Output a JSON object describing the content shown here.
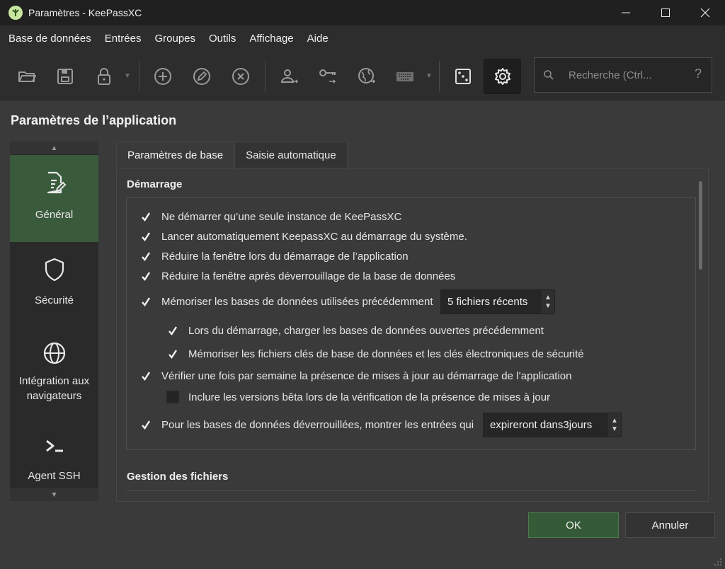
{
  "window": {
    "title": "Paramètres - KeePassXC",
    "controls": [
      "minimize",
      "maximize",
      "close"
    ]
  },
  "menu": [
    "Base de données",
    "Entrées",
    "Groupes",
    "Outils",
    "Affichage",
    "Aide"
  ],
  "toolbar": {
    "buttons": [
      "open-database",
      "save-database",
      "lock-database",
      "add-entry",
      "edit-entry",
      "delete-entry",
      "copy-username",
      "copy-password",
      "open-url",
      "auto-type",
      "password-generator",
      "settings"
    ],
    "search_placeholder": "Recherche (Ctrl...",
    "search_help": "?"
  },
  "page_title": "Paramètres de l’application",
  "categories": [
    {
      "label": "Général",
      "icon": "document-edit-icon",
      "active": true
    },
    {
      "label": "Sécurité",
      "icon": "shield-icon",
      "active": false
    },
    {
      "label": "Intégration aux navigateurs",
      "icon": "globe-icon",
      "active": false
    },
    {
      "label": "Agent SSH",
      "icon": "terminal-icon",
      "active": false
    }
  ],
  "tabs": [
    {
      "label": "Paramètres de base",
      "active": true
    },
    {
      "label": "Saisie automatique",
      "active": false
    }
  ],
  "startup": {
    "title": "Démarrage",
    "options": [
      {
        "label": "Ne démarrer qu’une seule instance de KeePassXC",
        "checked": true
      },
      {
        "label": "Lancer automatiquement KeepassXC au démarrage du système.",
        "checked": true
      },
      {
        "label": "Réduire la fenêtre lors du démarrage de l’application",
        "checked": true
      },
      {
        "label": "Réduire la fenêtre après déverrouillage de la base de données",
        "checked": true
      },
      {
        "label": "Mémoriser les bases de données utilisées précédemment",
        "checked": true
      },
      {
        "label": "Lors du démarrage, charger les bases de données ouvertes précédemment",
        "checked": true
      },
      {
        "label": "Mémoriser les fichiers clés de base de données et les clés électroniques de sécurité",
        "checked": true
      },
      {
        "label": "Vérifier une fois par semaine la présence de mises à jour au démarrage de l’application",
        "checked": true
      },
      {
        "label": "Inclure les versions bêta lors de la vérification de la présence de mises à jour",
        "checked": false
      },
      {
        "label": "Pour les bases de données déverrouillées, montrer les entrées qui",
        "checked": true
      }
    ],
    "recent_files_value": "5 fichiers récents",
    "expire_value": "expireront dans3jours"
  },
  "file_management": {
    "title": "Gestion des fichiers"
  },
  "buttons": {
    "ok": "OK",
    "cancel": "Annuler"
  },
  "colors": {
    "accent_green": "#3a5a3c",
    "ok_button": "#355a37",
    "background": "#3a3a3a"
  }
}
